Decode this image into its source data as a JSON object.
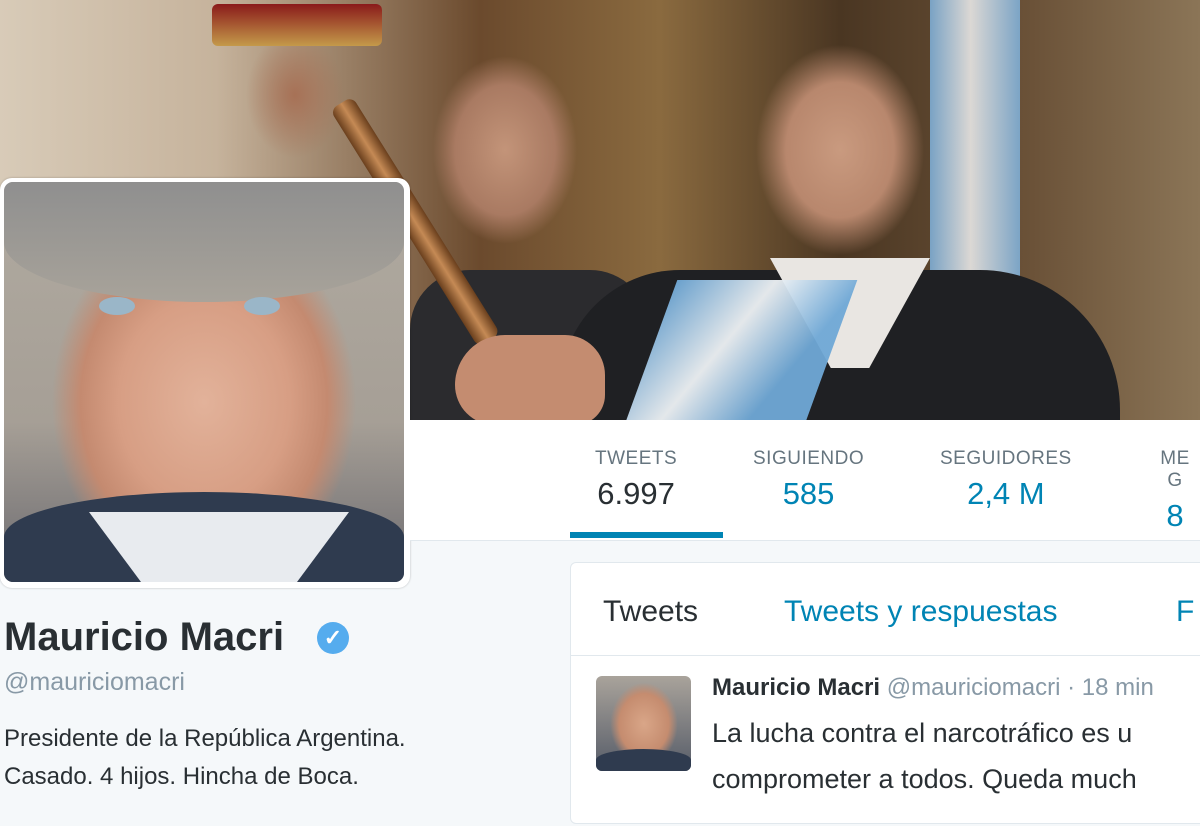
{
  "profile": {
    "name": "Mauricio Macri",
    "verified_mark": "✓",
    "handle": "@mauriciomacri",
    "bio_line1": "Presidente de la República Argentina.",
    "bio_line2": "Casado. 4 hijos. Hincha de Boca."
  },
  "stats": [
    {
      "label": "TWEETS",
      "value": "6.997"
    },
    {
      "label": "SIGUIENDO",
      "value": "585"
    },
    {
      "label": "SEGUIDORES",
      "value": "2,4 M"
    },
    {
      "label": "ME G",
      "value": "8"
    }
  ],
  "timeline": {
    "tabs": [
      "Tweets",
      "Tweets y respuestas",
      "F"
    ],
    "tweet": {
      "name": "Mauricio Macri",
      "handle": "@mauriciomacri",
      "separator": "·",
      "time": "18 min",
      "line1": "La lucha contra el narcotráfico es u",
      "line2": "comprometer a todos. Queda much"
    }
  },
  "colors": {
    "link": "#0084b4",
    "verified": "#55acee",
    "text": "#292f33",
    "muted": "#8899a6"
  }
}
